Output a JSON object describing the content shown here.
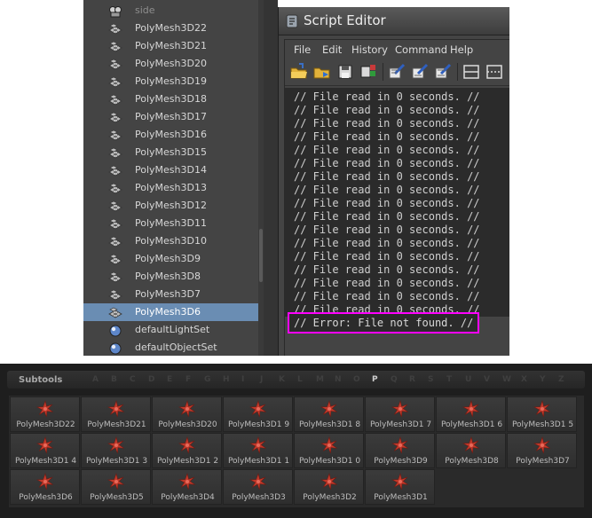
{
  "outliner": {
    "items": [
      {
        "label": "side",
        "icon": "camera-icon",
        "state": "dim"
      },
      {
        "label": "PolyMesh3D22",
        "icon": "mesh-icon",
        "state": "normal"
      },
      {
        "label": "PolyMesh3D21",
        "icon": "mesh-icon",
        "state": "normal"
      },
      {
        "label": "PolyMesh3D20",
        "icon": "mesh-icon",
        "state": "normal"
      },
      {
        "label": "PolyMesh3D19",
        "icon": "mesh-icon",
        "state": "normal"
      },
      {
        "label": "PolyMesh3D18",
        "icon": "mesh-icon",
        "state": "normal"
      },
      {
        "label": "PolyMesh3D17",
        "icon": "mesh-icon",
        "state": "normal"
      },
      {
        "label": "PolyMesh3D16",
        "icon": "mesh-icon",
        "state": "normal"
      },
      {
        "label": "PolyMesh3D15",
        "icon": "mesh-icon",
        "state": "normal"
      },
      {
        "label": "PolyMesh3D14",
        "icon": "mesh-icon",
        "state": "normal"
      },
      {
        "label": "PolyMesh3D13",
        "icon": "mesh-icon",
        "state": "normal"
      },
      {
        "label": "PolyMesh3D12",
        "icon": "mesh-icon",
        "state": "normal"
      },
      {
        "label": "PolyMesh3D11",
        "icon": "mesh-icon",
        "state": "normal"
      },
      {
        "label": "PolyMesh3D10",
        "icon": "mesh-icon",
        "state": "normal"
      },
      {
        "label": "PolyMesh3D9",
        "icon": "mesh-icon",
        "state": "normal"
      },
      {
        "label": "PolyMesh3D8",
        "icon": "mesh-icon",
        "state": "normal"
      },
      {
        "label": "PolyMesh3D7",
        "icon": "mesh-icon",
        "state": "normal"
      },
      {
        "label": "PolyMesh3D6",
        "icon": "mesh-icon",
        "state": "selected"
      },
      {
        "label": "defaultLightSet",
        "icon": "set-icon",
        "state": "normal"
      },
      {
        "label": "defaultObjectSet",
        "icon": "set-icon",
        "state": "normal"
      }
    ]
  },
  "script_editor": {
    "title": "Script Editor",
    "menus": [
      "File",
      "Edit",
      "History",
      "Command",
      "Help"
    ],
    "toolbar_icons": [
      "open-script-icon",
      "source-script-icon",
      "save-script-icon",
      "save-to-shelf-icon",
      "clear-history-icon",
      "clear-input-icon",
      "clear-all-icon",
      "show-history-icon",
      "show-input-icon"
    ],
    "output_lines": [
      "// File read in 0 seconds. //",
      "// File read in 0 seconds. //",
      "// File read in 0 seconds. //",
      "// File read in 0 seconds. //",
      "// File read in 0 seconds. //",
      "// File read in 0 seconds. //",
      "// File read in 0 seconds. //",
      "// File read in 0 seconds. //",
      "// File read in 0 seconds. //",
      "// File read in 0 seconds. //",
      "// File read in 0 seconds. //",
      "// File read in 0 seconds. //",
      "// File read in 0 seconds. //",
      "// File read in 0 seconds. //",
      "// File read in 0 seconds. //",
      "// File read in 0 seconds. //",
      "// File read in 0 seconds. //"
    ],
    "error_line": "// Error: File not found. //",
    "highlight_color": "#ff00ff"
  },
  "subtools": {
    "title": "Subtools",
    "alphabet": [
      "A",
      "B",
      "C",
      "D",
      "E",
      "F",
      "G",
      "H",
      "I",
      "J",
      "K",
      "L",
      "M",
      "N",
      "O",
      "P",
      "Q",
      "R",
      "S",
      "T",
      "U",
      "V",
      "W",
      "X",
      "Y",
      "Z"
    ],
    "active_letter": "P",
    "items": [
      "PolyMesh3D22",
      "PolyMesh3D21",
      "PolyMesh3D20",
      "PolyMesh3D1 9",
      "PolyMesh3D1 8",
      "PolyMesh3D1 7",
      "PolyMesh3D1 6",
      "PolyMesh3D1 5",
      "PolyMesh3D1 4",
      "PolyMesh3D1 3",
      "PolyMesh3D1 2",
      "PolyMesh3D1 1",
      "PolyMesh3D1 0",
      "PolyMesh3D9",
      "PolyMesh3D8",
      "PolyMesh3D7",
      "PolyMesh3D6",
      "PolyMesh3D5",
      "PolyMesh3D4",
      "PolyMesh3D3",
      "PolyMesh3D2",
      "PolyMesh3D1"
    ],
    "icon": "star-mesh-icon",
    "icon_color": "#c0392b"
  }
}
